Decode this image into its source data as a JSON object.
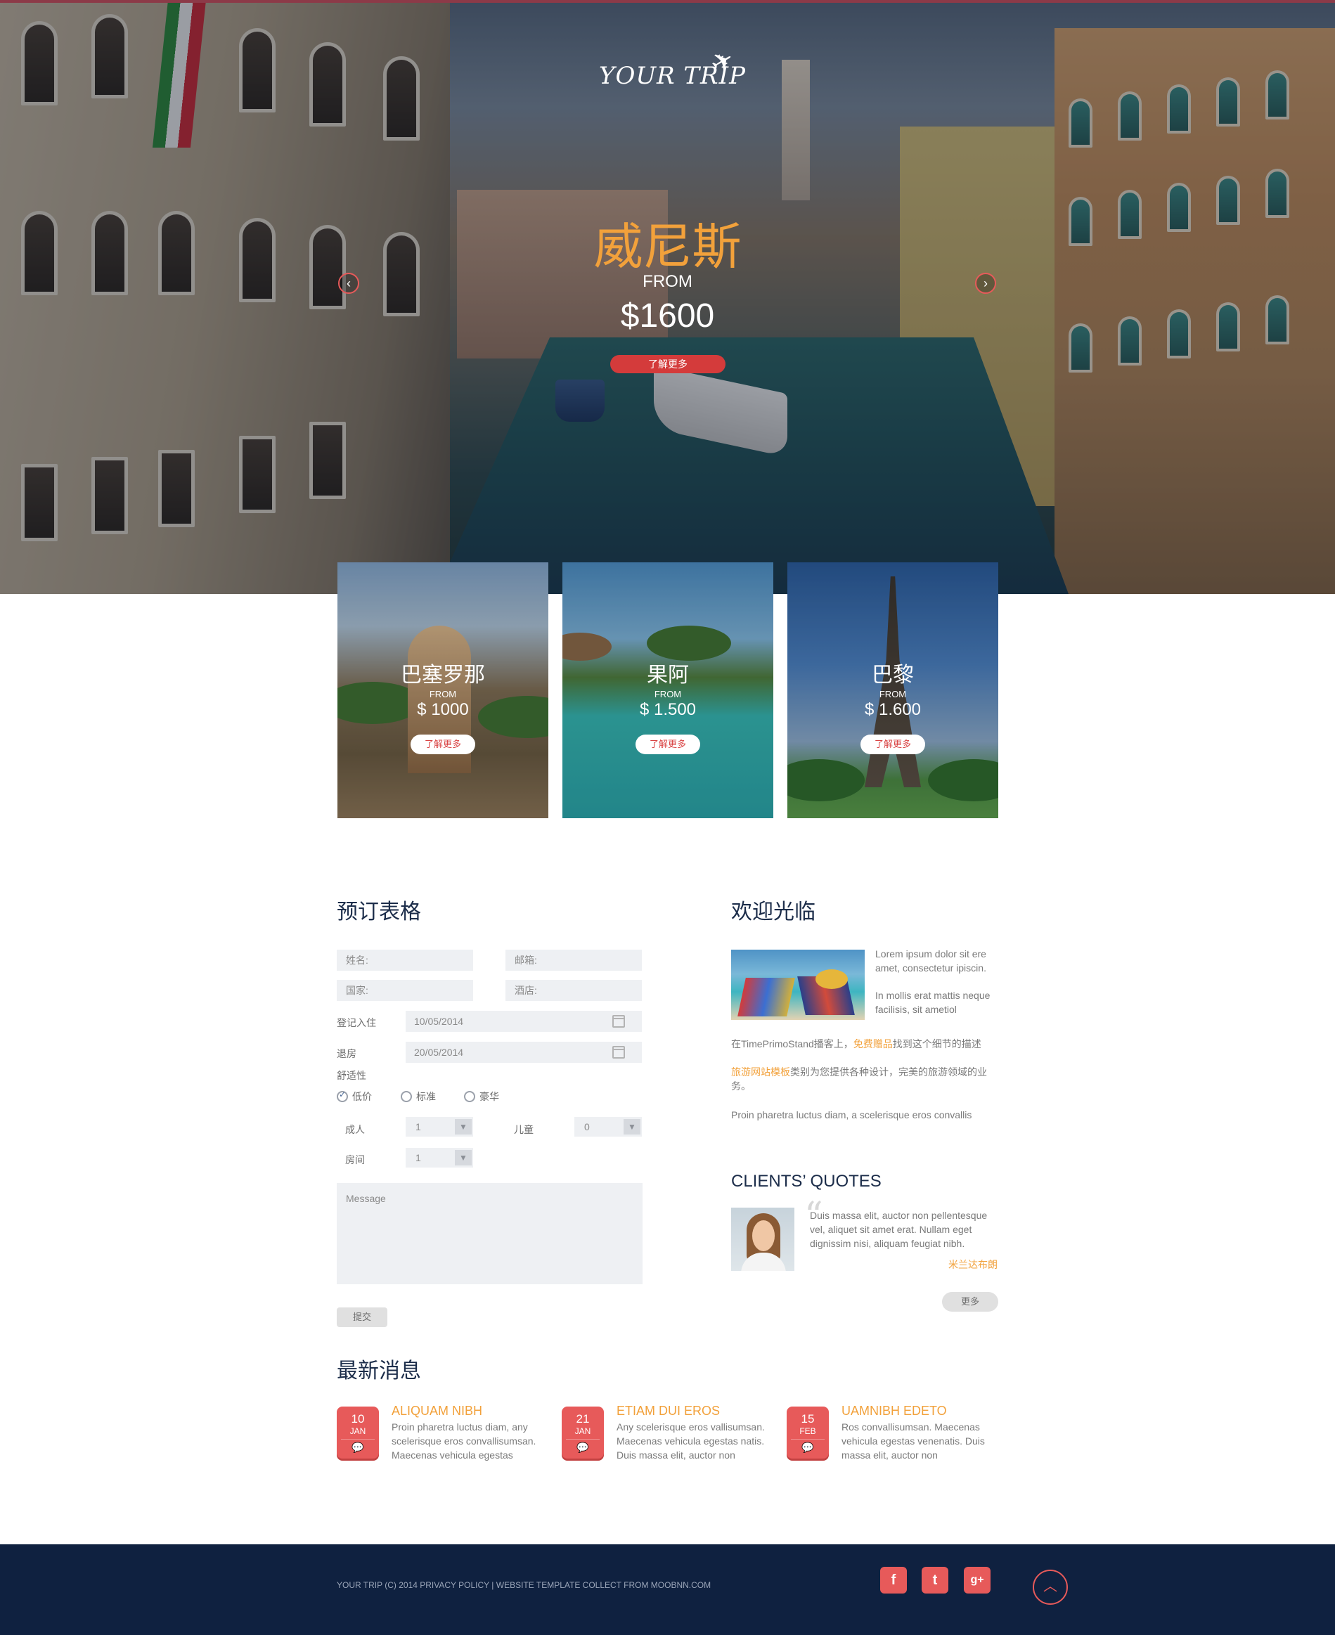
{
  "hero": {
    "logo": "YOUR TRIP",
    "title": "威尼斯",
    "from": "FROM",
    "price": "$1600",
    "button": "了解更多"
  },
  "destinations": [
    {
      "name": "巴塞罗那",
      "from": "FROM",
      "price": "$ 1000",
      "button": "了解更多"
    },
    {
      "name": "果阿",
      "from": "FROM",
      "price": "$ 1.500",
      "button": "了解更多"
    },
    {
      "name": "巴黎",
      "from": "FROM",
      "price": "$ 1.600",
      "button": "了解更多"
    }
  ],
  "booking": {
    "heading": "预订表格",
    "name_placeholder": "姓名:",
    "email_placeholder": "邮箱:",
    "country_placeholder": "国家:",
    "hotel_placeholder": "酒店:",
    "checkin_label": "登记入住",
    "checkin_value": "10/05/2014",
    "checkout_label": "退房",
    "checkout_value": "20/05/2014",
    "comfort_label": "舒适性",
    "comfort_options": [
      "低价",
      "标准",
      "豪华"
    ],
    "comfort_selected": "低价",
    "adults_label": "成人",
    "adults_value": "1",
    "children_label": "儿童",
    "children_value": "0",
    "rooms_label": "房间",
    "rooms_value": "1",
    "message_placeholder": "Message",
    "submit": "提交"
  },
  "welcome": {
    "heading": "欢迎光临",
    "intro1": "Lorem ipsum dolor sit ere amet, consectetur ipiscin.",
    "intro2": "In mollis erat mattis neque facilisis, sit ametiol",
    "line1_a": "在TimePrimoStand播客上，",
    "line1_link": "免费赠品",
    "line1_b": "找到这个细节的描述",
    "line2_link": "旅游网站模板",
    "line2_b": "类别为您提供各种设计，完美的旅游领域的业务。",
    "line3": "Proin pharetra luctus diam, a scelerisque eros convallis"
  },
  "quotes": {
    "heading": "CLIENTS’ QUOTES",
    "text": "Duis massa elit, auctor non pellentesque vel, aliquet sit amet erat. Nullam eget dignissim nisi, aliquam feugiat nibh.",
    "author": "米兰达布朗",
    "more": "更多"
  },
  "news": {
    "heading": "最新消息",
    "items": [
      {
        "day": "10",
        "month": "JAN",
        "title": "ALIQUAM NIBH",
        "text": "Proin pharetra luctus diam, any scelerisque eros convallisumsan. Maecenas vehicula egestas"
      },
      {
        "day": "21",
        "month": "JAN",
        "title": "ETIAM DUI EROS",
        "text": "Any scelerisque eros vallisumsan. Maecenas vehicula egestas natis. Duis massa elit, auctor non"
      },
      {
        "day": "15",
        "month": "FEB",
        "title": "UAMNIBH EDETO",
        "text": "Ros convallisumsan. Maecenas vehicula egestas venenatis. Duis massa elit, auctor non"
      }
    ]
  },
  "footer": {
    "text": "YOUR TRIP (C) 2014 PRIVACY POLICY | WEBSITE TEMPLATE COLLECT FROM MOOBNN.COM",
    "social": [
      {
        "icon": "facebook-icon",
        "glyph": "f"
      },
      {
        "icon": "twitter-icon",
        "glyph": "t"
      },
      {
        "icon": "google-plus-icon",
        "glyph": "g+"
      }
    ]
  },
  "colors": {
    "accent_orange": "#f2a13b",
    "accent_red": "#e75a5a",
    "heading_navy": "#1c2d4a",
    "footer_bg": "#0f2140"
  }
}
